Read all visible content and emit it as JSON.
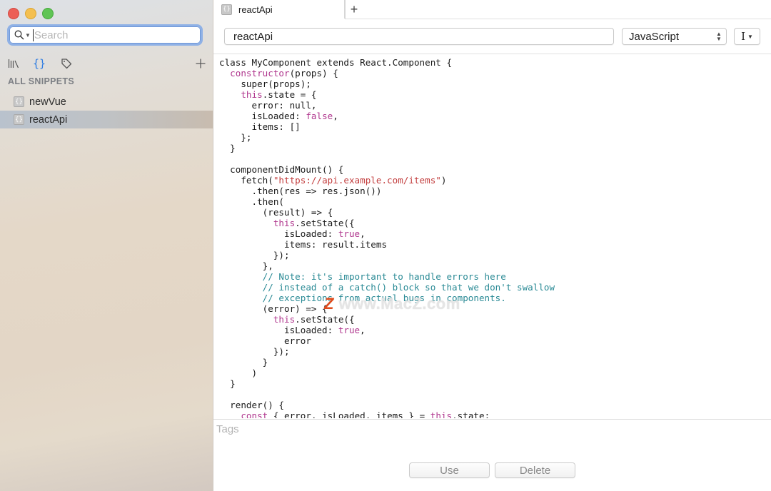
{
  "window": {
    "controls": [
      "close",
      "minimize",
      "zoom"
    ]
  },
  "sidebar": {
    "search": {
      "placeholder": "Search",
      "value": ""
    },
    "toolbar": {
      "library_icon": "library-icon",
      "snippets_icon": "braces-icon",
      "tags_icon": "tag-icon",
      "add_icon": "plus-icon"
    },
    "section_title": "ALL SNIPPETS",
    "items": [
      {
        "label": "newVue",
        "icon": "snippet-icon",
        "selected": false
      },
      {
        "label": "reactApi",
        "icon": "snippet-icon",
        "selected": true
      }
    ]
  },
  "main": {
    "tabs": [
      {
        "label": "reactApi",
        "active": true
      }
    ],
    "add_tab_label": "+",
    "title_value": "reactApi",
    "language": {
      "selected": "JavaScript"
    },
    "cursor_menu_icon": "ibeam-cursor-icon",
    "tags": {
      "placeholder": "Tags",
      "value": ""
    },
    "buttons": {
      "use": "Use",
      "delete": "Delete"
    },
    "watermark": {
      "z": "Z",
      "text": " www.MacZ.com"
    },
    "code_lines": [
      [
        [
          "",
          "class MyComponent extends React.Component {"
        ]
      ],
      [
        [
          "",
          "  "
        ],
        [
          "kw",
          "constructor"
        ],
        [
          "",
          "(props) {"
        ]
      ],
      [
        [
          "",
          "    super(props);"
        ]
      ],
      [
        [
          "",
          "    "
        ],
        [
          "kw",
          "this"
        ],
        [
          "",
          ".state = {"
        ]
      ],
      [
        [
          "",
          "      error: null,"
        ]
      ],
      [
        [
          "",
          "      isLoaded: "
        ],
        [
          "kw",
          "false"
        ],
        [
          "",
          ","
        ]
      ],
      [
        [
          "",
          "      items: []"
        ]
      ],
      [
        [
          "",
          "    };"
        ]
      ],
      [
        [
          "",
          "  }"
        ]
      ],
      [
        [
          "",
          ""
        ]
      ],
      [
        [
          "",
          "  componentDidMount() {"
        ]
      ],
      [
        [
          "",
          "    fetch("
        ],
        [
          "str",
          "\"https://api.example.com/items\""
        ],
        [
          "",
          ")"
        ]
      ],
      [
        [
          "",
          "      .then(res => res.json())"
        ]
      ],
      [
        [
          "",
          "      .then("
        ]
      ],
      [
        [
          "",
          "        (result) => {"
        ]
      ],
      [
        [
          "",
          "          "
        ],
        [
          "kw",
          "this"
        ],
        [
          "",
          ".setState({"
        ]
      ],
      [
        [
          "",
          "            isLoaded: "
        ],
        [
          "kw",
          "true"
        ],
        [
          "",
          ","
        ]
      ],
      [
        [
          "",
          "            items: result.items"
        ]
      ],
      [
        [
          "",
          "          });"
        ]
      ],
      [
        [
          "",
          "        },"
        ]
      ],
      [
        [
          "cm",
          "        // Note: it's important to handle errors here"
        ]
      ],
      [
        [
          "cm",
          "        // instead of a catch() block so that we don't swallow"
        ]
      ],
      [
        [
          "cm",
          "        // exceptions from actual bugs in components."
        ]
      ],
      [
        [
          "",
          "        (error) => {"
        ]
      ],
      [
        [
          "",
          "          "
        ],
        [
          "kw",
          "this"
        ],
        [
          "",
          ".setState({"
        ]
      ],
      [
        [
          "",
          "            isLoaded: "
        ],
        [
          "kw",
          "true"
        ],
        [
          "",
          ","
        ]
      ],
      [
        [
          "",
          "            error"
        ]
      ],
      [
        [
          "",
          "          });"
        ]
      ],
      [
        [
          "",
          "        }"
        ]
      ],
      [
        [
          "",
          "      )"
        ]
      ],
      [
        [
          "",
          "  }"
        ]
      ],
      [
        [
          "",
          ""
        ]
      ],
      [
        [
          "",
          "  render() {"
        ]
      ],
      [
        [
          "",
          "    "
        ],
        [
          "kw",
          "const"
        ],
        [
          "",
          " { error, isLoaded, items } = "
        ],
        [
          "kw",
          "this"
        ],
        [
          "",
          ".state;"
        ]
      ]
    ]
  },
  "colors": {
    "accent": "#2a7ae2",
    "keyword": "#b0378e",
    "string": "#c33e3e",
    "comment": "#2a8a95"
  }
}
